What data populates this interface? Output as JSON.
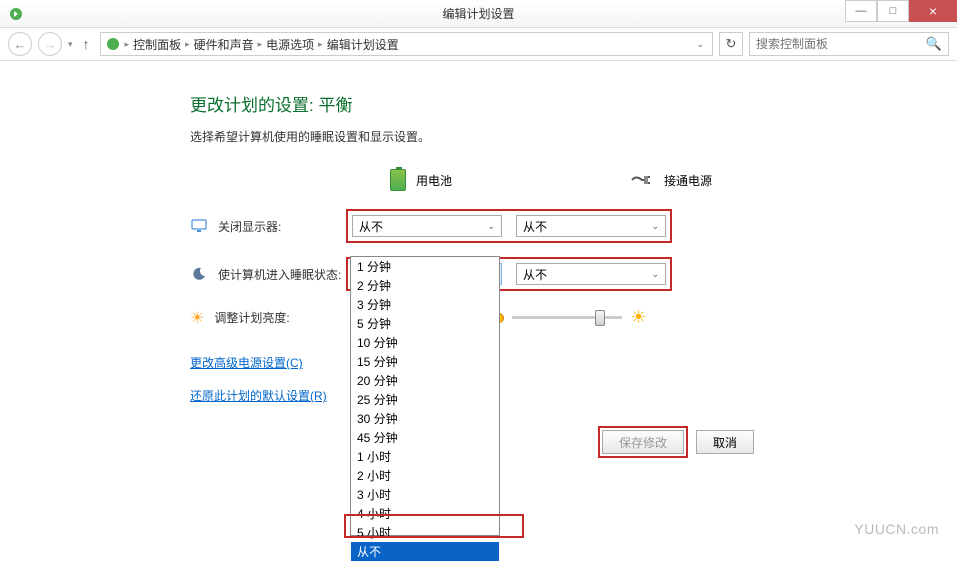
{
  "window": {
    "title": "编辑计划设置",
    "minimize": "—",
    "maximize": "□",
    "close": "×"
  },
  "nav": {
    "back": "←",
    "forward": "→",
    "up": "↑",
    "refresh": "↻",
    "search_placeholder": "搜索控制面板"
  },
  "breadcrumb": {
    "items": [
      "控制面板",
      "硬件和声音",
      "电源选项",
      "编辑计划设置"
    ]
  },
  "page": {
    "title": "更改计划的设置: 平衡",
    "subtitle": "选择希望计算机使用的睡眠设置和显示设置。"
  },
  "columns": {
    "battery": "用电池",
    "plugged": "接通电源"
  },
  "rows": {
    "display_off": "关闭显示器:",
    "sleep": "使计算机进入睡眠状态:",
    "brightness": "调整计划亮度:"
  },
  "dropdown_values": {
    "display_battery": "从不",
    "display_plugged": "从不",
    "sleep_battery": "从不",
    "sleep_plugged": "从不"
  },
  "dropdown_options": [
    "1 分钟",
    "2 分钟",
    "3 分钟",
    "5 分钟",
    "10 分钟",
    "15 分钟",
    "20 分钟",
    "25 分钟",
    "30 分钟",
    "45 分钟",
    "1 小时",
    "2 小时",
    "3 小时",
    "4 小时",
    "5 小时",
    "从不"
  ],
  "links": {
    "advanced": "更改高级电源设置(C)",
    "restore": "还原此计划的默认设置(R)"
  },
  "buttons": {
    "save": "保存修改",
    "cancel": "取消"
  },
  "watermark": "YUUCN.com"
}
